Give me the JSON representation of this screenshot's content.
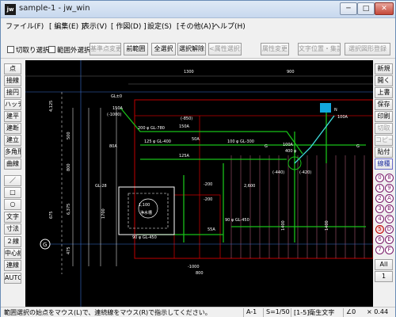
{
  "window": {
    "title": "sample-1 - jw_win",
    "app_icon": "jw"
  },
  "window_controls": {
    "minimize": "─",
    "maximize": "□",
    "close": "✕"
  },
  "menu": [
    "ファイル(F)",
    "[ 編集(E) ]",
    "表示(V)",
    "[ 作図(D) ]",
    "設定(S)",
    "[その他(A)]",
    "ヘルプ(H)"
  ],
  "toolbar": {
    "cut_select_label": "切取り選択",
    "outside_select_label": "範囲外選択",
    "base_point_change": "基準点変更",
    "prev_range": "前範囲",
    "select_all": "全選択",
    "select_cancel": "選択解除",
    "attr_select": "<属性選択>",
    "attr_change": "属性変更",
    "text_pos_collect": "文字位置・集計",
    "select_figure_register": "選択図形登録"
  },
  "left_tools": [
    "点",
    "接線",
    "接円",
    "ハッチ",
    "建平",
    "建断",
    "建立",
    "多角形",
    "曲線",
    "／",
    "□",
    "○",
    "文字",
    "寸法",
    "２線",
    "中心線",
    "連線",
    "AUTO"
  ],
  "right_tools": {
    "new": "新規",
    "open": "開く",
    "overwrite": "上書",
    "save": "保存",
    "print": "印刷",
    "cut": "切取",
    "copy": "コピー",
    "paste": "貼付",
    "layer": "線種",
    "all": "All",
    "one": "1"
  },
  "layers": [
    "0",
    "8",
    "1",
    "9",
    "2",
    "A",
    "3",
    "B",
    "4",
    "C",
    "5",
    "D",
    "6",
    "E",
    "7",
    "F"
  ],
  "drawing": {
    "dims_top": [
      "1300",
      "900"
    ],
    "pipe_labels": [
      "150A",
      "(-1000)",
      "200 φ GL-780",
      "80A",
      "125 φ GL-400",
      "100 φ GL-300",
      "50A",
      "(-850)",
      "(-440)",
      "(-420)",
      "125A",
      "100A",
      "150A"
    ],
    "left_dims": [
      "4,125",
      "500",
      "800",
      "6,375",
      "475",
      "675"
    ],
    "room_labels": [
      "1,100",
      "浄水槽",
      "90 φ GL-450"
    ],
    "grid_marker": "G",
    "misc": [
      "GL±0",
      "GL-28",
      "1700",
      "-200",
      "-200",
      "2,600",
      "90 φ GL-450",
      "1400",
      "55A",
      "800",
      "1400",
      "-1000",
      "G",
      "G",
      "N",
      "400 φ",
      "100A"
    ]
  },
  "status": {
    "message": "範囲選択の始点をマウス(L)で、連続線をマウス(R)で指示してください。",
    "layer": "A-1",
    "scale": "S=1/50",
    "layer_name": "[1-5]衛生文字",
    "angle": "∠0",
    "zoom": "× 0.44"
  }
}
